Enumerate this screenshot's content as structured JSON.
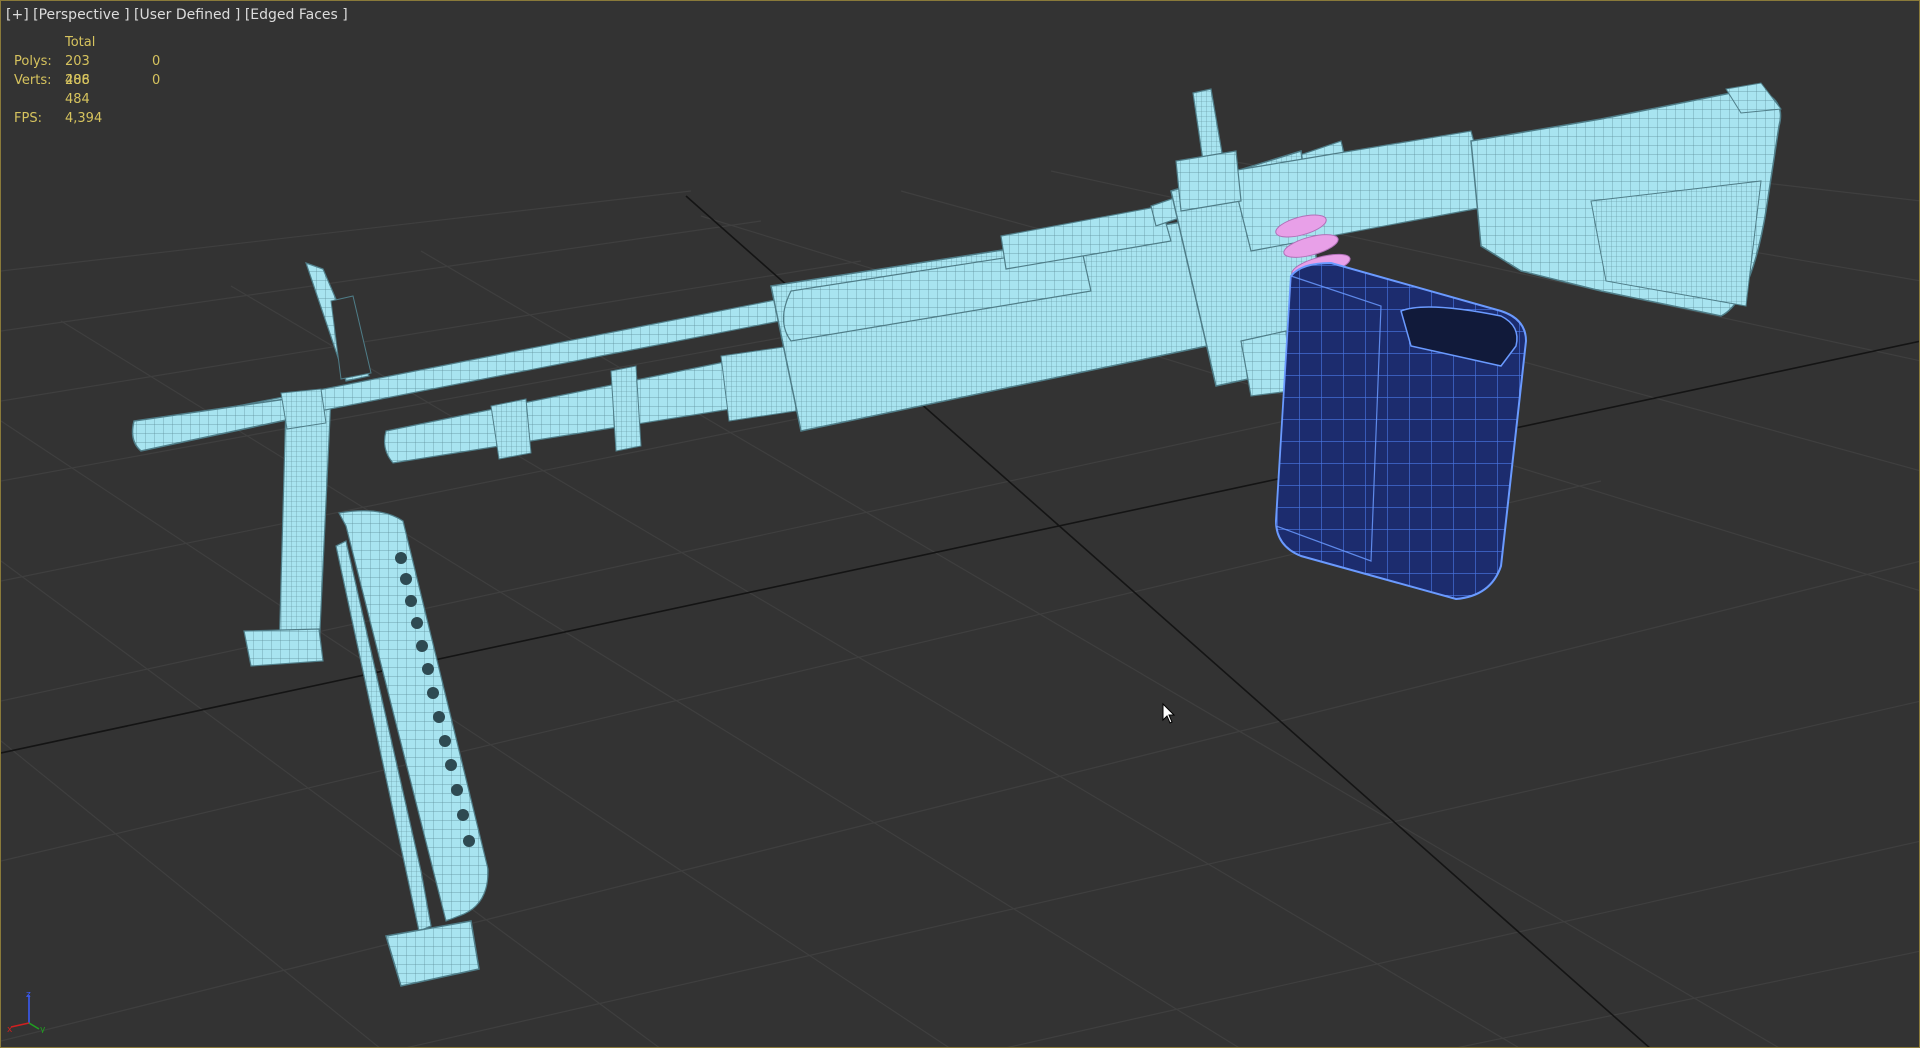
{
  "viewport": {
    "label_plus": "[+]",
    "label_view": "[Perspective ]",
    "label_shading": "[User Defined ]",
    "label_mode": "[Edged Faces ]",
    "border_color": "#8a7a3a",
    "background_color": "#333333"
  },
  "stats": {
    "header": "Total",
    "polys_label": "Polys:",
    "polys_total": "203 486",
    "polys_selected": "0",
    "verts_label": "Verts:",
    "verts_total": "208 484",
    "verts_selected": "0",
    "fps_label": "FPS:",
    "fps_value": "4,394",
    "text_color": "#d6c35e"
  },
  "model": {
    "name": "machine-gun-wireframe",
    "body_color": "#a8e4f0",
    "selected_part_color": "#3a5fd6",
    "ammo_color": "#e8a0e8"
  },
  "axis_gizmo": {
    "x_label": "x",
    "y_label": "y",
    "z_label": "z"
  }
}
